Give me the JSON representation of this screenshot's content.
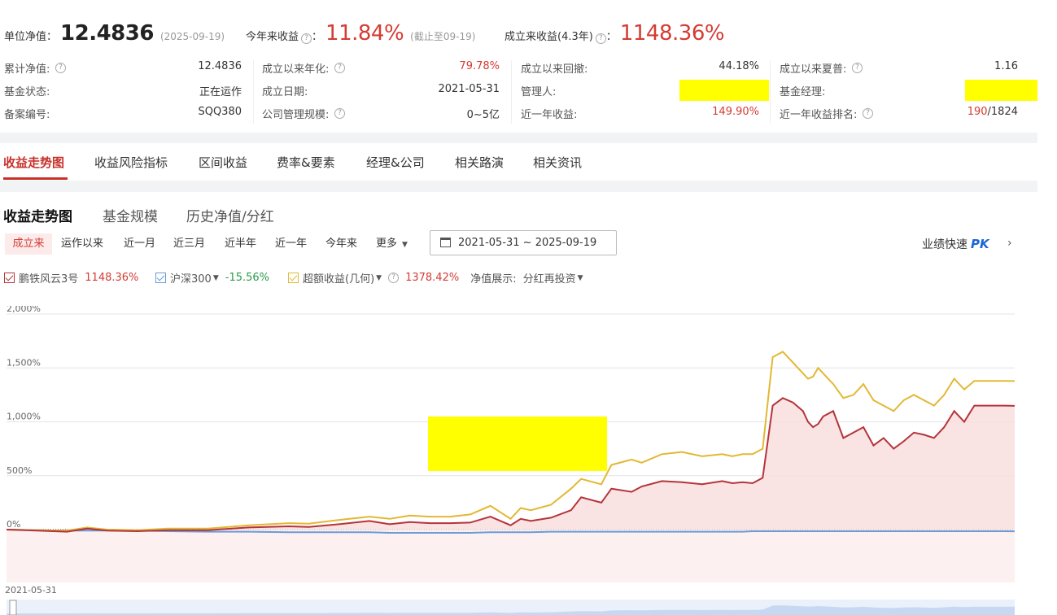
{
  "header": {
    "nav_label": "单位净值：",
    "nav_value": "12.4836",
    "nav_date": "(2025-09-19)",
    "ytd_label": "今年来收益",
    "ytd_value": "11.84%",
    "ytd_note": "(截止至09-19)",
    "since_label": "成立来收益(4.3年)",
    "since_value": "1148.36%"
  },
  "info_grid": [
    [
      {
        "label": "累计净值:",
        "value": "12.4836",
        "q": true
      },
      {
        "label": "成立以来年化:",
        "value": "79.78%",
        "q": true,
        "red": true
      },
      {
        "label": "成立以来回撤:",
        "value": "44.18%",
        "q": false
      },
      {
        "label": "成立以来夏普:",
        "value": "1.16",
        "q": true
      }
    ],
    [
      {
        "label": "基金状态:",
        "value": "正在运作"
      },
      {
        "label": "成立日期:",
        "value": "2021-05-31"
      },
      {
        "label": "管理人:",
        "value": ""
      },
      {
        "label": "基金经理:",
        "value": ""
      }
    ],
    [
      {
        "label": "备案编号:",
        "value": "SQQ380"
      },
      {
        "label": "公司管理规模:",
        "value": "0~5亿",
        "q": true
      },
      {
        "label": "近一年收益:",
        "value": "149.90%",
        "red": true
      },
      {
        "label": "近一年收益排名:",
        "value_red": "190",
        "value_rest": "/1824",
        "q": true
      }
    ]
  ],
  "tabs": [
    "收益走势图",
    "收益风险指标",
    "区间收益",
    "费率&要素",
    "经理&公司",
    "相关路演",
    "相关资讯"
  ],
  "subtabs": [
    "收益走势图",
    "基金规模",
    "历史净值/分红"
  ],
  "ranges": [
    "成立来",
    "运作以来",
    "近一月",
    "近三月",
    "近半年",
    "近一年",
    "今年来",
    "更多"
  ],
  "date_range": "2021-05-31 ~ 2025-09-19",
  "pk": {
    "label": "业绩快速",
    "badge": "PK"
  },
  "legend": {
    "fund_name": "鹏铁风云3号",
    "fund_value": "1148.36%",
    "bench_name": "沪深300",
    "bench_value": "-15.56%",
    "excess_name": "超额收益(几何)",
    "excess_value": "1378.42%",
    "nav_display_label": "净值展示:",
    "nav_display_value": "分红再投资"
  },
  "colors": {
    "fund": "#b5343a",
    "bench": "#6b9bd8",
    "excess": "#e2b833",
    "accent": "#c8322b"
  },
  "chart_data": {
    "type": "line",
    "ylim": [
      0,
      2000
    ],
    "y_ticks": [
      "0%",
      "500%",
      "1,000%",
      "1,500%",
      "2,000%"
    ],
    "x_start_label": "2021-05-31",
    "x": [
      0,
      0.03,
      0.06,
      0.08,
      0.1,
      0.13,
      0.16,
      0.2,
      0.24,
      0.28,
      0.3,
      0.33,
      0.36,
      0.38,
      0.4,
      0.42,
      0.44,
      0.46,
      0.48,
      0.5,
      0.51,
      0.52,
      0.54,
      0.56,
      0.57,
      0.59,
      0.6,
      0.62,
      0.63,
      0.65,
      0.67,
      0.69,
      0.71,
      0.72,
      0.73,
      0.74,
      0.75,
      0.76,
      0.77,
      0.78,
      0.79,
      0.795,
      0.8,
      0.805,
      0.81,
      0.82,
      0.83,
      0.84,
      0.85,
      0.86,
      0.87,
      0.88,
      0.89,
      0.9,
      0.91,
      0.92,
      0.93,
      0.94,
      0.95,
      0.96,
      0.97,
      0.98,
      0.99,
      1.0
    ],
    "series": [
      {
        "name": "鹏铁风云3号",
        "values": [
          0,
          -10,
          -20,
          10,
          -10,
          -15,
          -5,
          -5,
          20,
          30,
          25,
          50,
          80,
          50,
          70,
          60,
          60,
          65,
          120,
          40,
          100,
          80,
          110,
          180,
          300,
          250,
          380,
          350,
          400,
          450,
          440,
          420,
          450,
          430,
          440,
          430,
          480,
          1150,
          1220,
          1180,
          1100,
          1000,
          950,
          980,
          1050,
          1100,
          850,
          900,
          950,
          780,
          850,
          750,
          820,
          900,
          880,
          850,
          950,
          1100,
          1000,
          1150,
          1150,
          1150,
          1150,
          1148
        ]
      },
      {
        "name": "沪深300",
        "values": [
          0,
          -5,
          -10,
          -10,
          -10,
          -10,
          -15,
          -20,
          -20,
          -25,
          -25,
          -25,
          -25,
          -30,
          -30,
          -30,
          -30,
          -30,
          -25,
          -25,
          -25,
          -25,
          -20,
          -20,
          -20,
          -20,
          -20,
          -20,
          -20,
          -20,
          -20,
          -20,
          -20,
          -20,
          -20,
          -15,
          -15,
          -15,
          -15,
          -15,
          -15,
          -15,
          -15,
          -15,
          -15,
          -15,
          -15,
          -15,
          -15,
          -15,
          -15,
          -15,
          -15,
          -15,
          -15,
          -15,
          -15,
          -15,
          -15,
          -15,
          -15,
          -15,
          -15,
          -16
        ]
      },
      {
        "name": "超额收益(几何)",
        "values": [
          0,
          -5,
          -10,
          20,
          0,
          -5,
          10,
          10,
          40,
          60,
          55,
          90,
          120,
          100,
          130,
          120,
          120,
          140,
          220,
          100,
          200,
          180,
          230,
          380,
          470,
          420,
          600,
          650,
          620,
          700,
          720,
          680,
          700,
          680,
          700,
          700,
          750,
          1600,
          1650,
          1550,
          1450,
          1400,
          1420,
          1500,
          1450,
          1350,
          1220,
          1250,
          1350,
          1200,
          1150,
          1100,
          1200,
          1250,
          1200,
          1150,
          1250,
          1400,
          1300,
          1380,
          1380,
          1380,
          1380,
          1378
        ]
      }
    ]
  }
}
